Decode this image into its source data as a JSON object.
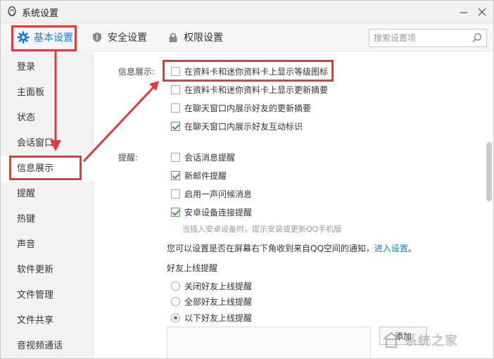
{
  "window": {
    "title": "系统设置"
  },
  "toolbar": {
    "tabs": [
      {
        "label": "基本设置",
        "icon": "gear-icon",
        "active": true
      },
      {
        "label": "安全设置",
        "icon": "shield-icon",
        "active": false
      },
      {
        "label": "权限设置",
        "icon": "lock-icon",
        "active": false
      }
    ],
    "search": {
      "placeholder": "搜索设置项",
      "value": ""
    }
  },
  "sidebar": {
    "items": [
      {
        "label": "登录"
      },
      {
        "label": "主面板"
      },
      {
        "label": "状态"
      },
      {
        "label": "会话窗口"
      },
      {
        "label": "信息展示",
        "active": true
      },
      {
        "label": "提醒"
      },
      {
        "label": "热键"
      },
      {
        "label": "声音"
      },
      {
        "label": "软件更新"
      },
      {
        "label": "文件管理"
      },
      {
        "label": "文件共享"
      },
      {
        "label": "音视频通话"
      }
    ]
  },
  "main": {
    "info_display": {
      "label": "信息展示:",
      "options": [
        {
          "label": "在资料卡和迷你资料卡上显示等级图标",
          "checked": false
        },
        {
          "label": "在资料卡和迷你资料卡上显示更新摘要",
          "checked": false
        },
        {
          "label": "在聊天窗口内展示好友的更新摘要",
          "checked": false
        },
        {
          "label": "在聊天窗口内展示好友互动标识",
          "checked": true
        }
      ]
    },
    "reminder": {
      "label": "提醒:",
      "options": [
        {
          "label": "会话消息提醒",
          "checked": false
        },
        {
          "label": "新邮件提醒",
          "checked": true
        },
        {
          "label": "启用一声问候消息",
          "checked": false
        },
        {
          "label": "安卓设备连接提醒",
          "checked": true
        }
      ],
      "android_hint": "当插入安卓设备时，提示安装或更新QQ手机版",
      "qzone_notice_text": "您可以设置是否在屏幕右下角收到来自QQ空间的通知，",
      "qzone_notice_link": "进入设置",
      "qzone_notice_end": "。"
    },
    "friend_online": {
      "label": "好友上线提醒",
      "options": [
        {
          "label": "关闭好友上线提醒",
          "selected": false
        },
        {
          "label": "全部好友上线提醒",
          "selected": false
        },
        {
          "label": "以下好友上线提醒",
          "selected": true
        }
      ],
      "add_button": "添加"
    }
  },
  "colors": {
    "accent": "#1a7bd6",
    "check": "#3ea533",
    "annotation": "#e23a3a"
  },
  "watermark": {
    "text": "系统之家"
  }
}
